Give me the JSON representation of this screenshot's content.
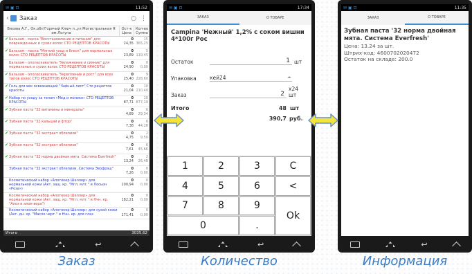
{
  "left_phone": {
    "status_time": "11:52",
    "title": "Заказ",
    "header": {
      "name": "Вязова А.Г., Ок.обл'Горячий Ключ п.,ул Могистральная Я им.Логуна",
      "col2": "Ост-к\nЦена",
      "col3": "Кол-во\nСумма"
    },
    "rows": [
      {
        "name": "Бальзам - маска \"Восстановление и питание\" для поврежденных и сухих волос СТО РЕЦЕПТОВ КРАСОТЫ",
        "color": "#d43c3c",
        "check": true,
        "v1": "0",
        "v2": "24,35",
        "v3": "15",
        "v4": "365,25"
      },
      {
        "name": "Бальзам - маска \"Мягкий уход и блеск\" для нормальных волос СТО РЕЦЕПТОВ КРАСОТЫ",
        "color": "#d43c3c",
        "check": true,
        "v1": "0",
        "v2": "23,89",
        "v3": "5",
        "v4": "119,45"
      },
      {
        "name": "Бальзам - ополаскиватель \"Увлажнение и сияние\" для нормальных и сухих волос СТО РЕЦЕПТОВ КРАСОТЫ",
        "color": "#d43c3c",
        "check": false,
        "v1": "0",
        "v2": "24,90",
        "v3": "0",
        "v4": "0,00"
      },
      {
        "name": "Бальзам - ополаскиватель \"Укрепление и рост\" для всех типов волос СТО РЕЦЕПТОВ КРАСОТЫ",
        "color": "#d43c3c",
        "check": true,
        "v1": "0",
        "v2": "25,40",
        "v3": "9",
        "v4": "228,60"
      },
      {
        "name": "Гель для век освежающий \"Чайный лист\" Сто рецептов красоты",
        "color": "#2a3ecf",
        "check": true,
        "v1": "0",
        "v2": "21,04",
        "v3": "10",
        "v4": "210,40"
      },
      {
        "name": "Набор по уходу за телом «Мед и молоко» СТО РЕЦЕПТОВ КРАСОТЫ",
        "color": "#2a3ecf",
        "check": true,
        "v1": "0",
        "v2": "87,71",
        "v3": "10",
        "v4": "877,10"
      },
      {
        "name": "Зубная паста \"32 витамины и минералы\"",
        "color": "#d43c3c",
        "check": true,
        "v1": "0",
        "v2": "4,89",
        "v3": "6",
        "v4": "29,34"
      },
      {
        "name": "Зубная паста \"32 кальций и фтор\"",
        "color": "#d43c3c",
        "check": true,
        "v1": "0",
        "v2": "7,38",
        "v3": "6",
        "v4": "44,28"
      },
      {
        "name": "Зубная паста \"32 экстракт облепихи\"",
        "color": "#d43c3c",
        "check": true,
        "v1": "0",
        "v2": "4,75",
        "v3": "2",
        "v4": "9,50"
      },
      {
        "name": "Зубная паста \"32 экстракт облепихи\"",
        "color": "#d43c3c",
        "check": true,
        "v1": "0",
        "v2": "7,61",
        "v3": "6",
        "v4": "45,66"
      },
      {
        "name": "Зубная паста \"32 норма двойная мята. Система Everfresh\"",
        "color": "#d43c3c",
        "check": true,
        "v1": "0",
        "v2": "13,24",
        "v3": "2",
        "v4": "26,48"
      },
      {
        "name": "Зубная паста \"32 экстракт облепихи. Система Эвофрэш\"",
        "color": "#2a3ecf",
        "check": false,
        "v1": "0",
        "v2": "7,26",
        "v3": "0",
        "v4": "0,00"
      },
      {
        "name": "Косметический набор «Апотекер Шеллер» для нормальной кожи (Акт. защ. кр. \"Мгл. млт.\" и Лосьон «Роза»)",
        "color": "#2a3ecf",
        "check": false,
        "v1": "0",
        "v2": "200,94",
        "v3": "0",
        "v4": "0,00"
      },
      {
        "name": "Косметический набор «Апотекер Шеллер» для нормальной кожи (Акт. защ. кр. \"Мгл. млт.\" и Нчн. кр. \"Алоэ и алое-вера\")",
        "color": "#d43c3c",
        "check": false,
        "v1": "0",
        "v2": "182,21",
        "v3": "0",
        "v4": "0,00"
      },
      {
        "name": "Косметический набор «Апотекер Шеллер» для сухой кожи (Акт. дн. кр. \"Масло черт.\" и Нчн. кр. для глаз",
        "color": "#2a3ecf",
        "check": false,
        "v1": "0",
        "v2": "171,41",
        "v3": "0",
        "v4": "0,00"
      }
    ],
    "total_label": "Итого",
    "total_value": "3035,62"
  },
  "middle_phone": {
    "status_time": "17:34",
    "tab1": "ЗАКАЗ",
    "tab2": "О ТОВАРЕ",
    "product": "Campina 'Нежный' 1,2% с соком вишни 4*100г Рос",
    "fields": [
      {
        "label": "Остаток",
        "value": "1",
        "unit": "шт"
      },
      {
        "label": "Упаковка",
        "value": "кей24",
        "unit": ""
      },
      {
        "label": "Заказ",
        "value": "2",
        "unit": "х24 шт"
      }
    ],
    "total_label": "Итого",
    "total_qty": "48",
    "total_qty_unit": "шт",
    "total_sum": "390,7",
    "total_sum_unit": "руб.",
    "keys": [
      "1",
      "2",
      "3",
      "C",
      "4",
      "5",
      "6",
      "<",
      "7",
      "8",
      "9",
      "Ok",
      "0",
      "."
    ]
  },
  "right_phone": {
    "status_time": "11:35",
    "tab1": "ЗАКАЗ",
    "tab2": "О ТОВАРЕ",
    "title": "Зубная паста '32 норма двойная мята. Система Everfresh'",
    "price": "Цена: 13.24 за шт.",
    "barcode": "Штрих-код: 4600702020472",
    "stock": "Остаток на складе: 200.0"
  },
  "captions": [
    "Заказ",
    "Количество",
    "Информация"
  ],
  "colors": {
    "accent": "#3a7cc4",
    "arrow": "#f2e43a",
    "arrow_stroke": "#6b91c8"
  }
}
